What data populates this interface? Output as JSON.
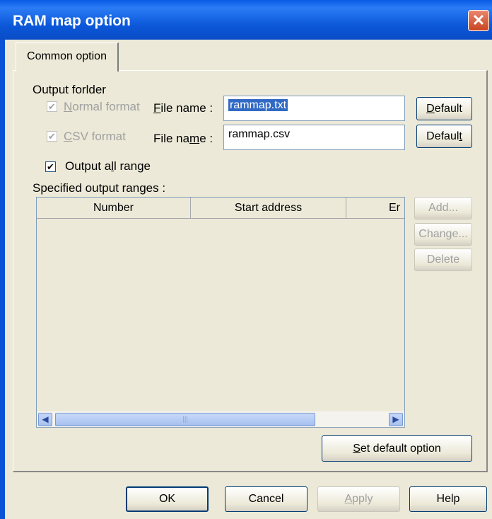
{
  "window": {
    "title": "RAM map option",
    "close_symbol": "✕"
  },
  "tabs": [
    {
      "label": "Common option"
    }
  ],
  "output_folder": {
    "label": "Output forlder",
    "normal_format": {
      "label_pre": "",
      "label_key": "N",
      "label_post": "ormal format",
      "checked": true,
      "enabled": false
    },
    "csv_format": {
      "label_pre": "",
      "label_key": "C",
      "label_post": "SV format",
      "checked": true,
      "enabled": false
    },
    "file_name_1": {
      "label_pre": "",
      "label_key": "F",
      "label_post": "ile name :",
      "value": "rammap.txt"
    },
    "file_name_2": {
      "label_pre": "File na",
      "label_key": "m",
      "label_post": "e :",
      "value": "rammap.csv"
    },
    "default_1": {
      "pre": "",
      "key": "D",
      "post": "efault"
    },
    "default_2": {
      "pre": "Defaul",
      "key": "t",
      "post": ""
    }
  },
  "output_all_range": {
    "pre": "Output a",
    "key": "l",
    "post": "l range",
    "checked": true
  },
  "ranges": {
    "label": "Specified output ranges :",
    "columns": [
      "Number",
      "Start address",
      "Er"
    ],
    "rows": []
  },
  "range_buttons": {
    "add": "Add...",
    "change": "Change...",
    "delete": "Delete"
  },
  "set_default": {
    "pre": "",
    "key": "S",
    "post": "et default option"
  },
  "footer": {
    "ok": "OK",
    "cancel": "Cancel",
    "apply_key": "A",
    "apply_post": "pply",
    "help": "Help"
  },
  "glyphs": {
    "check": "✔",
    "left_arrow": "◀",
    "right_arrow": "▶",
    "grip": "|||"
  }
}
